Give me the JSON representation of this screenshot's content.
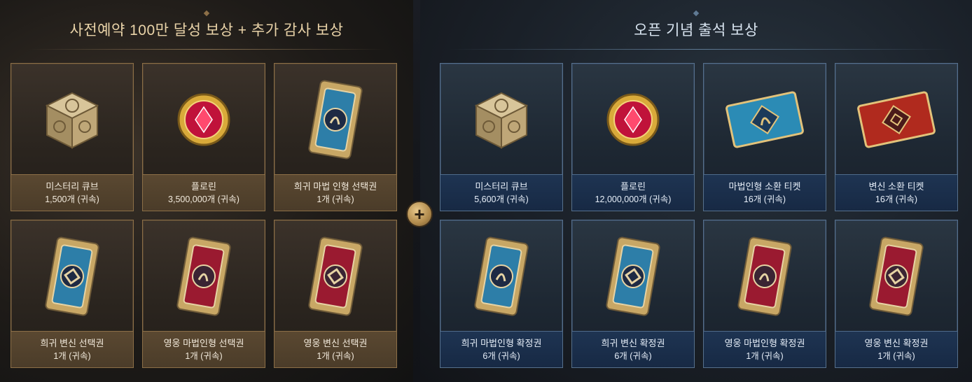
{
  "left_section": {
    "title": "사전예약 100만 달성 보상 + 추가 감사 보상",
    "items": [
      {
        "name": "미스터리 큐브",
        "qty": "1,500개 (귀속)",
        "icon": "mystery-cube-icon"
      },
      {
        "name": "플로린",
        "qty": "3,500,000개 (귀속)",
        "icon": "florin-gem-icon"
      },
      {
        "name": "희귀 마법 인형 선택권",
        "qty": "1개 (귀속)",
        "icon": "blue-magic-doll-card-icon"
      },
      {
        "name": "희귀 변신 선택권",
        "qty": "1개 (귀속)",
        "icon": "blue-transform-card-icon"
      },
      {
        "name": "영웅 마법인형 선택권",
        "qty": "1개 (귀속)",
        "icon": "red-magic-doll-card-icon"
      },
      {
        "name": "영웅 변신 선택권",
        "qty": "1개 (귀속)",
        "icon": "red-transform-card-icon"
      }
    ]
  },
  "right_section": {
    "title": "오픈 기념 출석 보상",
    "items": [
      {
        "name": "미스터리 큐브",
        "qty": "5,600개  (귀속)",
        "icon": "mystery-cube-icon"
      },
      {
        "name": "플로린",
        "qty": "12,000,000개 (귀속)",
        "icon": "florin-gem-icon"
      },
      {
        "name": "마법인형 소환 티켓",
        "qty": "16개 (귀속)",
        "icon": "blue-summon-ticket-icon"
      },
      {
        "name": "변신 소환 티켓",
        "qty": "16개 (귀속)",
        "icon": "red-summon-ticket-icon"
      },
      {
        "name": "희귀 마법인형 확정권",
        "qty": "6개 (귀속)",
        "icon": "blue-magic-doll-card-icon"
      },
      {
        "name": "희귀 변신 확정권",
        "qty": "6개 (귀속)",
        "icon": "blue-transform-card-icon"
      },
      {
        "name": "영웅 마법인형 확정권",
        "qty": "1개 (귀속)",
        "icon": "red-magic-doll-card-icon"
      },
      {
        "name": "영웅 변신 확정권",
        "qty": "1개 (귀속)",
        "icon": "red-transform-card-icon"
      }
    ]
  },
  "plus_symbol": "+",
  "colors": {
    "gold_accent": "#e9d3a8",
    "blue_accent": "#d8e4f0",
    "gold_border": "#8c6f47",
    "blue_border": "#56708c"
  }
}
